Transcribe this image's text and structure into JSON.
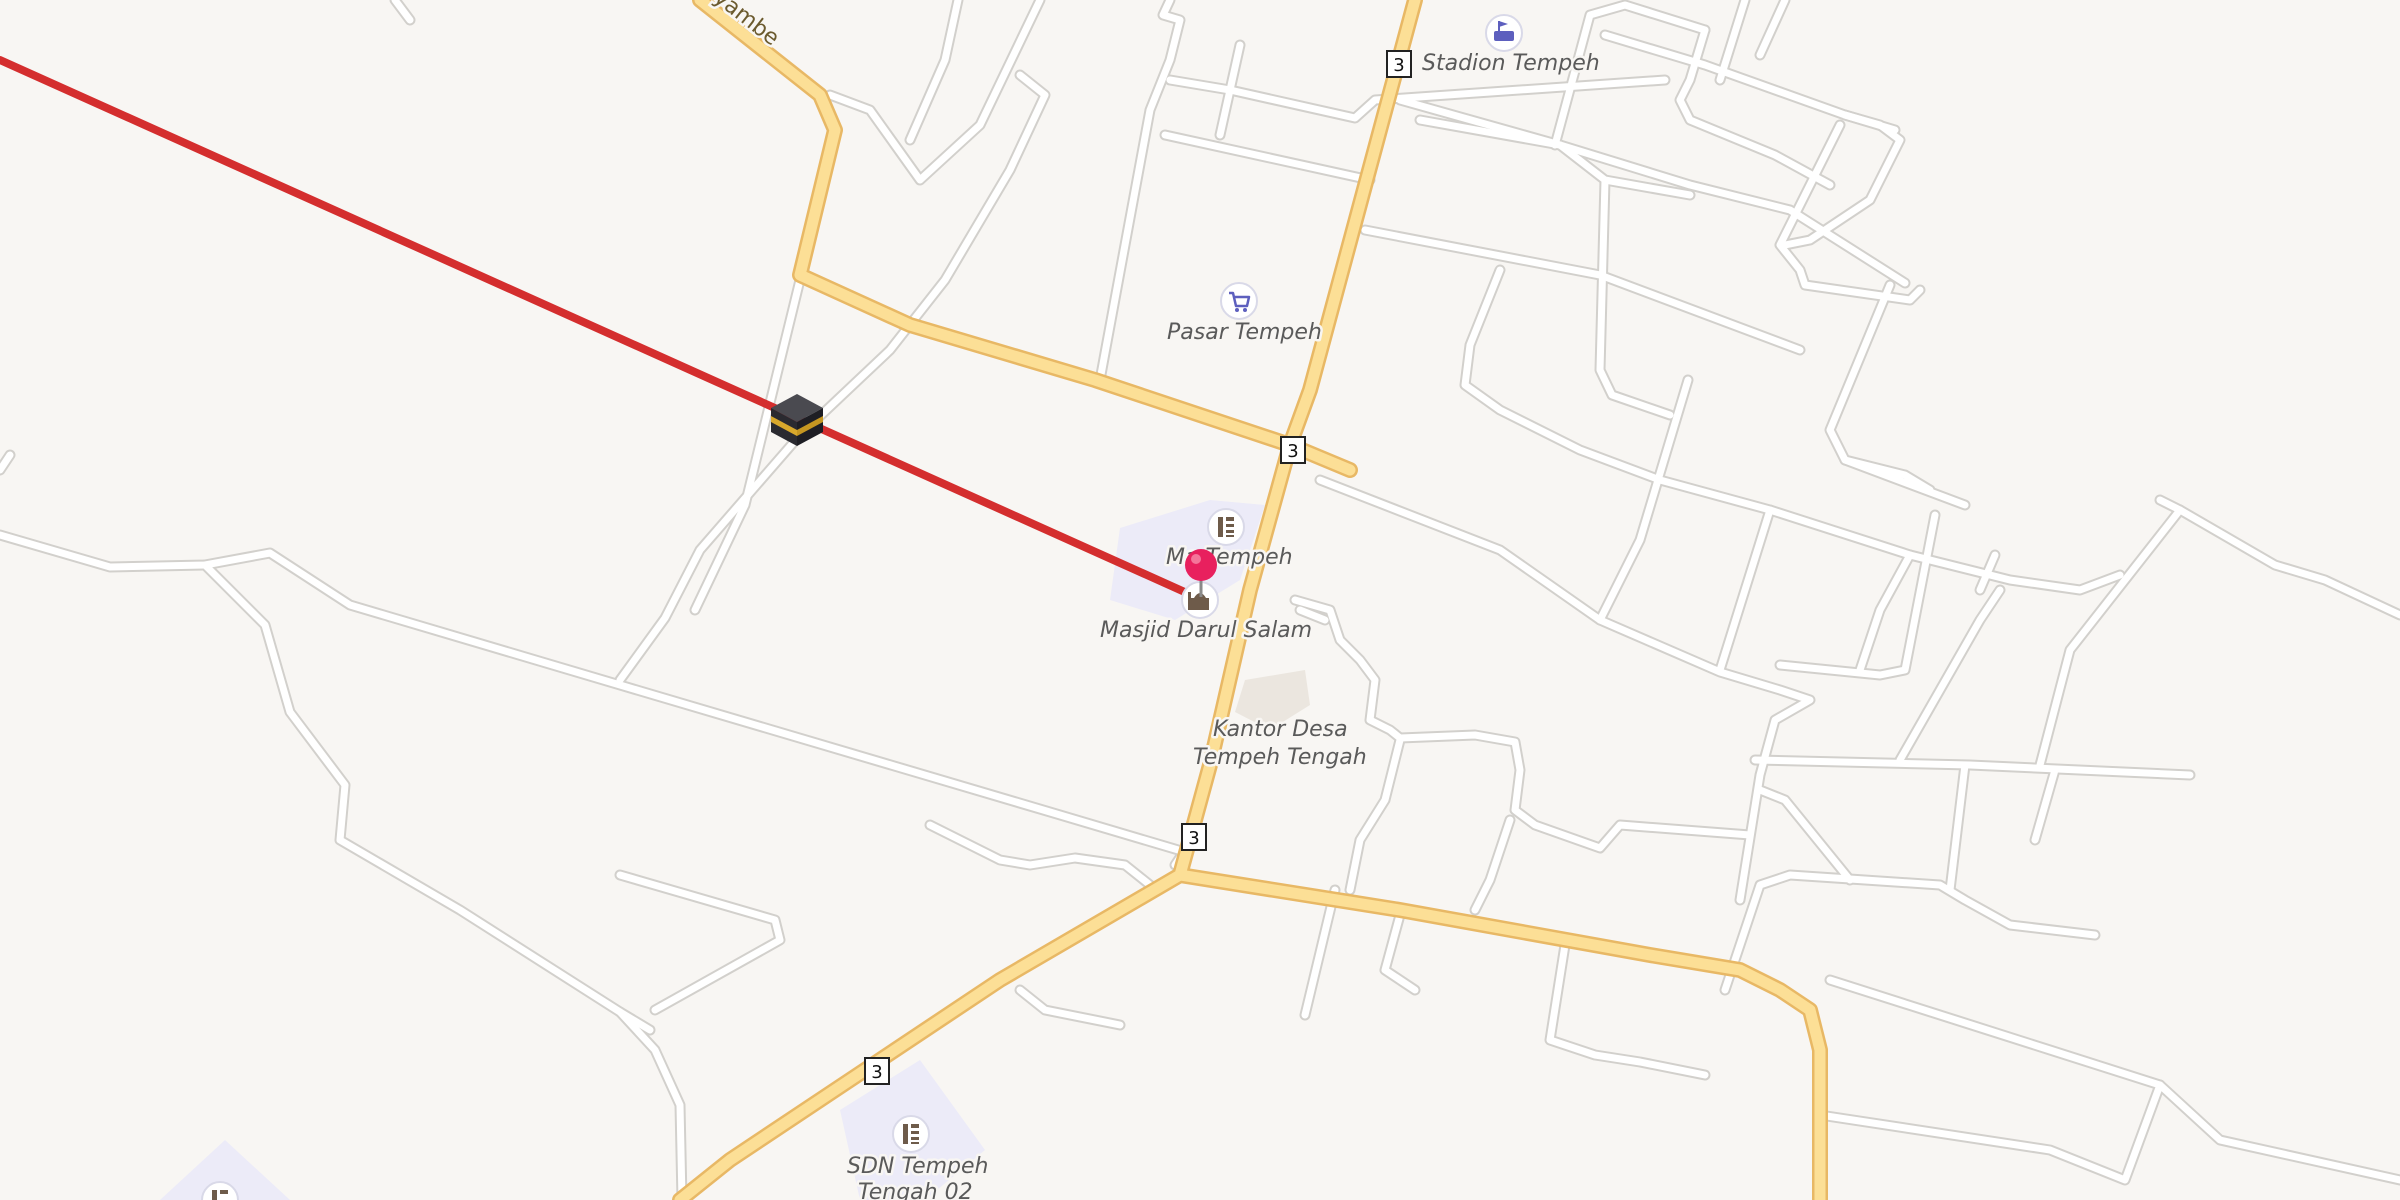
{
  "map": {
    "route_shield_label": "3",
    "road_name_fragment": "yambe",
    "qibla_line_color": "#d42e2e",
    "main_road_color": "#fcdf96",
    "minor_road_color": "#ffffff",
    "land_color": "#f8f6f3",
    "poi_color": "#5d5fbe",
    "marker_color": "#e8205e",
    "pois": {
      "stadium": {
        "label": "Stadion Tempeh",
        "icon": "stadium-icon"
      },
      "market": {
        "label": "Pasar Tempeh",
        "icon": "shopping-cart-icon"
      },
      "school_ma": {
        "label": "Ma Tempeh",
        "icon": "school-icon"
      },
      "mosque": {
        "label": "Masjid Darul Salam",
        "icon": "mosque-icon"
      },
      "village_office": {
        "label_line1": "Kantor Desa",
        "label_line2": "Tempeh Tengah"
      },
      "school_sdn": {
        "label_line1": "SDN Tempeh",
        "label_line2": "Tengah 02",
        "icon": "school-icon"
      }
    },
    "kaaba": {
      "icon": "kaaba-icon"
    },
    "location_marker": {
      "icon": "location-pin-icon"
    }
  }
}
